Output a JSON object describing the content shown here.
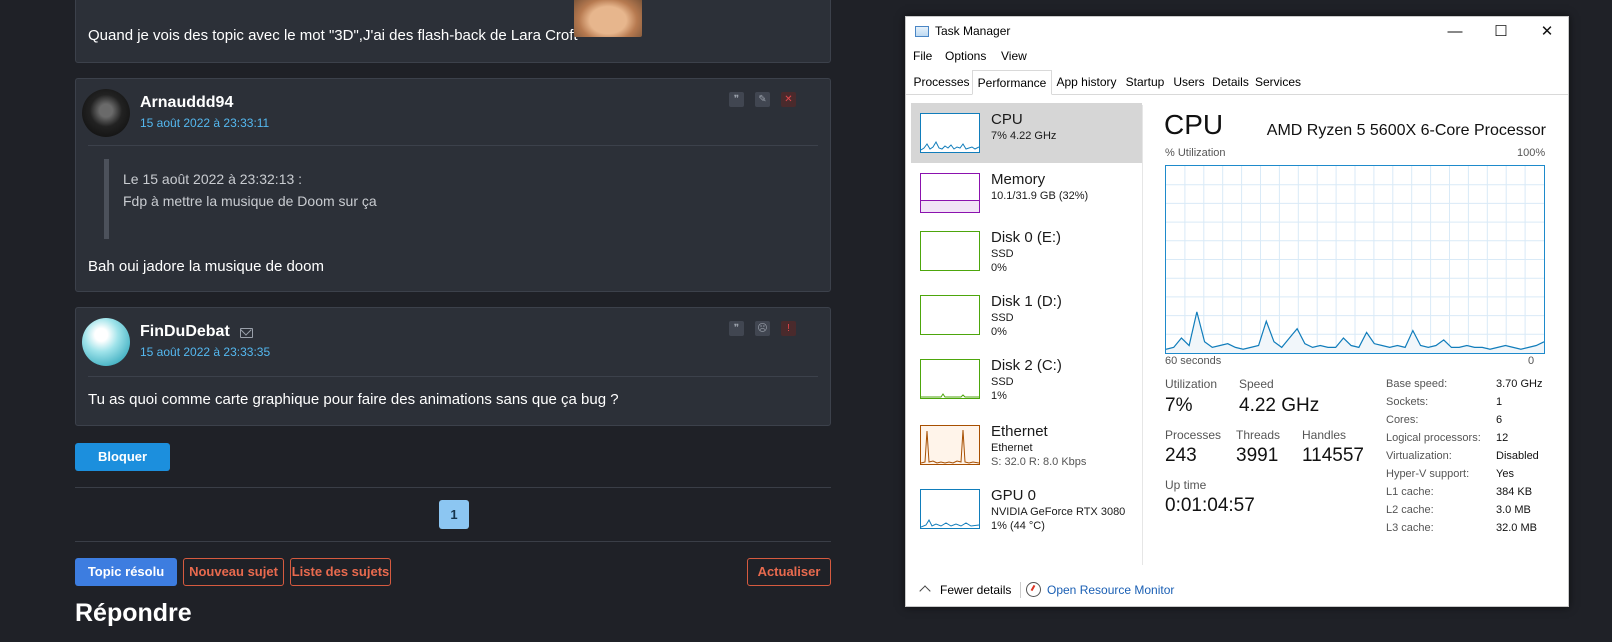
{
  "forum": {
    "post1": {
      "text": "Quand je vois des topic avec le mot \"3D\",J'ai des flash-back de Lara Croft"
    },
    "post2": {
      "author": "Arnauddd94",
      "date": "15 août 2022 à 23:33:11",
      "quote_header": "Le 15 août 2022 à 23:32:13 :",
      "quote_text": "Fdp à mettre la musique de Doom sur ça",
      "text": "Bah oui jadore la musique de doom"
    },
    "post3": {
      "author": "FinDuDebat",
      "date": "15 août 2022 à 23:33:35",
      "text": "Tu as quoi comme carte graphique pour faire des animations sans que ça bug ?"
    },
    "block_button": "Bloquer",
    "page_number": "1",
    "buttons": {
      "resolved": "Topic résolu",
      "new_topic": "Nouveau sujet",
      "topic_list": "Liste des sujets",
      "refresh": "Actualiser"
    },
    "reply_heading": "Répondre"
  },
  "task_manager": {
    "title": "Task Manager",
    "menu": [
      "File",
      "Options",
      "View"
    ],
    "tabs": [
      "Processes",
      "Performance",
      "App history",
      "Startup",
      "Users",
      "Details",
      "Services"
    ],
    "active_tab": "Performance",
    "sidebar": [
      {
        "name": "CPU",
        "sub1": "7% 4.22 GHz",
        "sub2": "",
        "color": "#117dbb"
      },
      {
        "name": "Memory",
        "sub1": "10.1/31.9 GB (32%)",
        "sub2": "",
        "color": "#8b12ae"
      },
      {
        "name": "Disk 0 (E:)",
        "sub1": "SSD",
        "sub2": "0%",
        "color": "#4da60c"
      },
      {
        "name": "Disk 1 (D:)",
        "sub1": "SSD",
        "sub2": "0%",
        "color": "#4da60c"
      },
      {
        "name": "Disk 2 (C:)",
        "sub1": "SSD",
        "sub2": "1%",
        "color": "#4da60c"
      },
      {
        "name": "Ethernet",
        "sub1": "Ethernet",
        "sub2": "S: 32.0  R: 8.0 Kbps",
        "color": "#a74f01"
      },
      {
        "name": "GPU 0",
        "sub1": "NVIDIA GeForce RTX 3080",
        "sub2": "1% (44 °C)",
        "color": "#117dbb"
      }
    ],
    "cpu": {
      "title": "CPU",
      "model": "AMD Ryzen 5 5600X 6-Core Processor",
      "util_label": "% Utilization",
      "max_label": "100%",
      "time_label": "60 seconds",
      "zero_label": "0",
      "utilization_label": "Utilization",
      "utilization": "7%",
      "speed_label": "Speed",
      "speed": "4.22 GHz",
      "processes_label": "Processes",
      "processes": "243",
      "threads_label": "Threads",
      "threads": "3991",
      "handles_label": "Handles",
      "handles": "114557",
      "uptime_label": "Up time",
      "uptime": "0:01:04:57",
      "specs": [
        {
          "k": "Base speed:",
          "v": "3.70 GHz"
        },
        {
          "k": "Sockets:",
          "v": "1"
        },
        {
          "k": "Cores:",
          "v": "6"
        },
        {
          "k": "Logical processors:",
          "v": "12"
        },
        {
          "k": "Virtualization:",
          "v": "Disabled"
        },
        {
          "k": "Hyper-V support:",
          "v": "Yes"
        },
        {
          "k": "L1 cache:",
          "v": "384 KB"
        },
        {
          "k": "L2 cache:",
          "v": "3.0 MB"
        },
        {
          "k": "L3 cache:",
          "v": "32.0 MB"
        }
      ],
      "history": [
        2,
        3,
        8,
        4,
        22,
        6,
        3,
        4,
        5,
        3,
        2,
        3,
        4,
        17,
        6,
        3,
        8,
        13,
        5,
        3,
        4,
        3,
        3,
        8,
        4,
        3,
        11,
        5,
        4,
        3,
        4,
        3,
        12,
        4,
        3,
        4,
        7,
        3,
        3,
        4,
        3,
        3,
        2,
        3,
        4,
        3,
        2,
        3,
        4,
        6
      ],
      "color": "#117dbb"
    },
    "footer": {
      "fewer": "Fewer details",
      "resource_monitor": "Open Resource Monitor"
    }
  }
}
